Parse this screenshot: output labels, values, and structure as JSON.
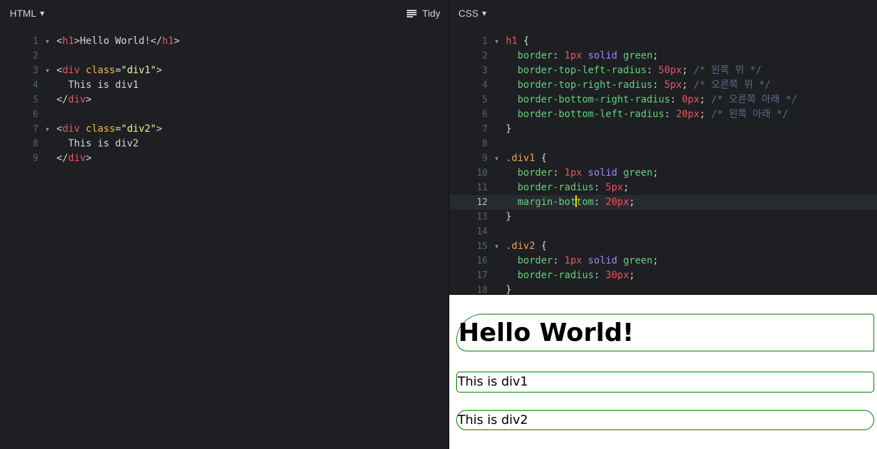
{
  "html_panel": {
    "title": "HTML",
    "caret": "▼",
    "tidy_label": "Tidy",
    "lines": [
      {
        "n": "1",
        "fold": true,
        "tokens": [
          [
            "brk",
            "<"
          ],
          [
            "tag",
            "h1"
          ],
          [
            "brk",
            ">"
          ],
          [
            "txt",
            "Hello World!"
          ],
          [
            "brk",
            "</"
          ],
          [
            "tag",
            "h1"
          ],
          [
            "brk",
            ">"
          ]
        ]
      },
      {
        "n": "2",
        "fold": false,
        "tokens": []
      },
      {
        "n": "3",
        "fold": true,
        "tokens": [
          [
            "brk",
            "<"
          ],
          [
            "tag",
            "div"
          ],
          [
            "txt",
            " "
          ],
          [
            "attr",
            "class"
          ],
          [
            "brk",
            "="
          ],
          [
            "str",
            "\"div1\""
          ],
          [
            "brk",
            ">"
          ]
        ]
      },
      {
        "n": "4",
        "fold": false,
        "tokens": [
          [
            "txt",
            "  This is div1"
          ]
        ]
      },
      {
        "n": "5",
        "fold": false,
        "tokens": [
          [
            "brk",
            "</"
          ],
          [
            "tag",
            "div"
          ],
          [
            "brk",
            ">"
          ]
        ]
      },
      {
        "n": "6",
        "fold": false,
        "tokens": []
      },
      {
        "n": "7",
        "fold": true,
        "tokens": [
          [
            "brk",
            "<"
          ],
          [
            "tag",
            "div"
          ],
          [
            "txt",
            " "
          ],
          [
            "attr",
            "class"
          ],
          [
            "brk",
            "="
          ],
          [
            "str",
            "\"div2\""
          ],
          [
            "brk",
            ">"
          ]
        ]
      },
      {
        "n": "8",
        "fold": false,
        "tokens": [
          [
            "txt",
            "  This is div2"
          ]
        ]
      },
      {
        "n": "9",
        "fold": false,
        "tokens": [
          [
            "brk",
            "</"
          ],
          [
            "tag",
            "div"
          ],
          [
            "brk",
            ">"
          ]
        ]
      }
    ]
  },
  "css_panel": {
    "title": "CSS",
    "caret": "▼",
    "active_line": "12",
    "lines": [
      {
        "n": "1",
        "fold": true,
        "tokens": [
          [
            "tag",
            "h1"
          ],
          [
            "brk",
            " {"
          ]
        ]
      },
      {
        "n": "2",
        "fold": false,
        "tokens": [
          [
            "txt",
            "  "
          ],
          [
            "prop",
            "border"
          ],
          [
            "brk",
            ": "
          ],
          [
            "num",
            "1px"
          ],
          [
            "txt",
            " "
          ],
          [
            "kw",
            "solid"
          ],
          [
            "txt",
            " "
          ],
          [
            "prop",
            "green"
          ],
          [
            "brk",
            ";"
          ]
        ]
      },
      {
        "n": "3",
        "fold": false,
        "tokens": [
          [
            "txt",
            "  "
          ],
          [
            "prop",
            "border-top-left-radius"
          ],
          [
            "brk",
            ": "
          ],
          [
            "num",
            "50px"
          ],
          [
            "brk",
            "; "
          ],
          [
            "cmt",
            "/* 왼쪽 위 */"
          ]
        ]
      },
      {
        "n": "4",
        "fold": false,
        "tokens": [
          [
            "txt",
            "  "
          ],
          [
            "prop",
            "border-top-right-radius"
          ],
          [
            "brk",
            ": "
          ],
          [
            "num",
            "5px"
          ],
          [
            "brk",
            "; "
          ],
          [
            "cmt",
            "/* 오른쪽 위 */"
          ]
        ]
      },
      {
        "n": "5",
        "fold": false,
        "tokens": [
          [
            "txt",
            "  "
          ],
          [
            "prop",
            "border-bottom-right-radius"
          ],
          [
            "brk",
            ": "
          ],
          [
            "num",
            "0px"
          ],
          [
            "brk",
            "; "
          ],
          [
            "cmt",
            "/* 오른쪽 아래 */"
          ]
        ]
      },
      {
        "n": "6",
        "fold": false,
        "tokens": [
          [
            "txt",
            "  "
          ],
          [
            "prop",
            "border-bottom-left-radius"
          ],
          [
            "brk",
            ": "
          ],
          [
            "num",
            "20px"
          ],
          [
            "brk",
            "; "
          ],
          [
            "cmt",
            "/* 왼쪽 아래 */"
          ]
        ]
      },
      {
        "n": "7",
        "fold": false,
        "tokens": [
          [
            "brk",
            "}"
          ]
        ]
      },
      {
        "n": "8",
        "fold": false,
        "tokens": []
      },
      {
        "n": "9",
        "fold": true,
        "tokens": [
          [
            "sel",
            ".div1"
          ],
          [
            "brk",
            " {"
          ]
        ]
      },
      {
        "n": "10",
        "fold": false,
        "tokens": [
          [
            "txt",
            "  "
          ],
          [
            "prop",
            "border"
          ],
          [
            "brk",
            ": "
          ],
          [
            "num",
            "1px"
          ],
          [
            "txt",
            " "
          ],
          [
            "kw",
            "solid"
          ],
          [
            "txt",
            " "
          ],
          [
            "prop",
            "green"
          ],
          [
            "brk",
            ";"
          ]
        ]
      },
      {
        "n": "11",
        "fold": false,
        "tokens": [
          [
            "txt",
            "  "
          ],
          [
            "prop",
            "border-radius"
          ],
          [
            "brk",
            ": "
          ],
          [
            "num",
            "5px"
          ],
          [
            "brk",
            ";"
          ]
        ]
      },
      {
        "n": "12",
        "fold": false,
        "tokens": [
          [
            "txt",
            "  "
          ],
          [
            "prop",
            "margin-bot"
          ],
          [
            "cursor",
            ""
          ],
          [
            "prop",
            "tom"
          ],
          [
            "brk",
            ": "
          ],
          [
            "num",
            "20px"
          ],
          [
            "brk",
            ";"
          ]
        ]
      },
      {
        "n": "13",
        "fold": false,
        "tokens": [
          [
            "brk",
            "}"
          ]
        ]
      },
      {
        "n": "14",
        "fold": false,
        "tokens": []
      },
      {
        "n": "15",
        "fold": true,
        "tokens": [
          [
            "sel",
            ".div2"
          ],
          [
            "brk",
            " {"
          ]
        ]
      },
      {
        "n": "16",
        "fold": false,
        "tokens": [
          [
            "txt",
            "  "
          ],
          [
            "prop",
            "border"
          ],
          [
            "brk",
            ": "
          ],
          [
            "num",
            "1px"
          ],
          [
            "txt",
            " "
          ],
          [
            "kw",
            "solid"
          ],
          [
            "txt",
            " "
          ],
          [
            "prop",
            "green"
          ],
          [
            "brk",
            ";"
          ]
        ]
      },
      {
        "n": "17",
        "fold": false,
        "tokens": [
          [
            "txt",
            "  "
          ],
          [
            "prop",
            "border-radius"
          ],
          [
            "brk",
            ": "
          ],
          [
            "num",
            "30px"
          ],
          [
            "brk",
            ";"
          ]
        ]
      },
      {
        "n": "18",
        "fold": false,
        "tokens": [
          [
            "brk",
            "}"
          ]
        ]
      }
    ]
  },
  "preview": {
    "h1_text": "Hello World!",
    "div1_text": "This is div1",
    "div2_text": "This is div2",
    "border_color": "#008000"
  },
  "colors": {
    "editor_bg": "#1d1f23",
    "tag": "#f0535e",
    "property": "#66d17a",
    "number": "#f0535e",
    "keyword": "#9b8cf5",
    "comment": "#5d6b86",
    "string": "#f6ef9b",
    "attribute": "#f8b84e",
    "selector": "#f5a25d",
    "cursor": "#ffd700"
  },
  "icons": {
    "tidy": "tidy-lines-icon",
    "fold": "fold-triangle-icon"
  }
}
